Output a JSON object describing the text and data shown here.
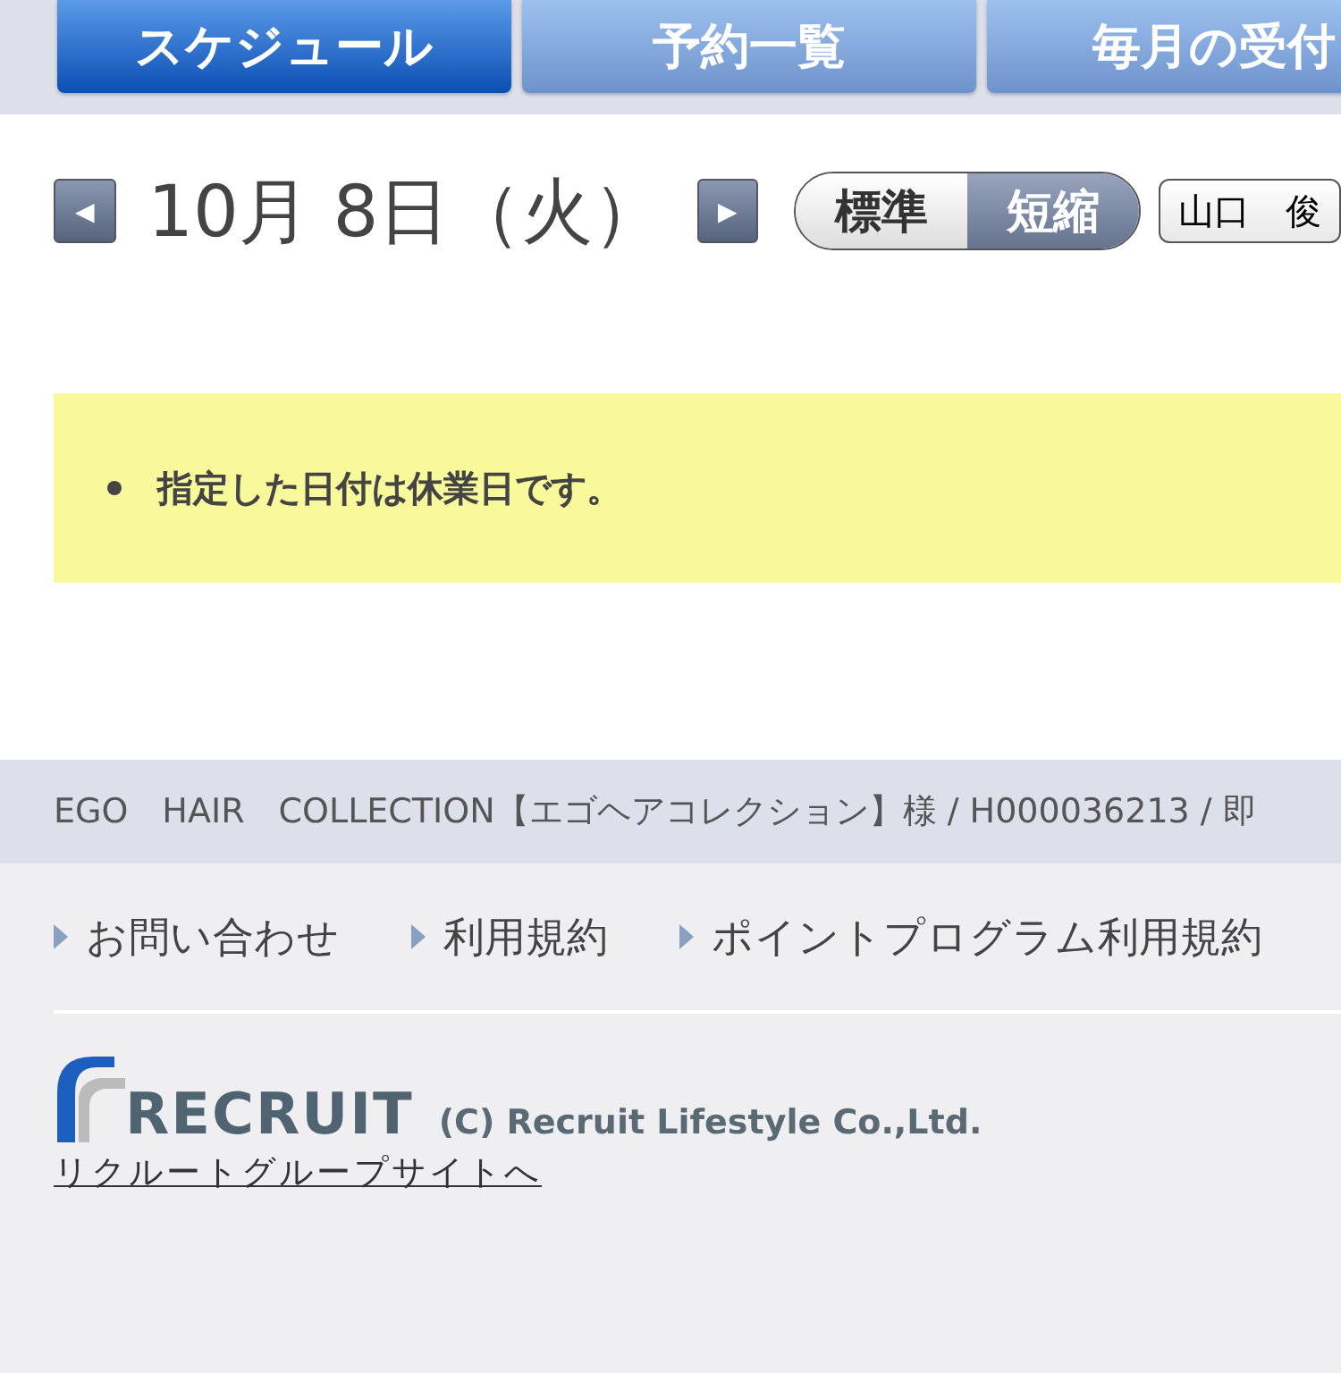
{
  "tabs": [
    {
      "label": "スケジュール",
      "selected": true
    },
    {
      "label": "予約一覧",
      "selected": false
    },
    {
      "label": "毎月の受付",
      "selected": false
    }
  ],
  "date_bar": {
    "prev": "◀",
    "date": "10月 8日（火）",
    "next": "▶",
    "view_modes": [
      {
        "label": "標準",
        "selected": false
      },
      {
        "label": "短縮",
        "selected": true
      }
    ],
    "staff_select": "山口　俊"
  },
  "notice": {
    "messages": [
      "指定した日付は休業日です。"
    ]
  },
  "salon_info": "EGO　HAIR　COLLECTION【エゴヘアコレクション】様 / H000036213 / 即",
  "footer": {
    "links": [
      "お問い合わせ",
      "利用規約",
      "ポイントプログラム利用規約"
    ],
    "logo": "RECRUIT",
    "copyright": "(C) Recruit Lifestyle Co.,Ltd.",
    "group_link": "リクルートグループサイトへ"
  }
}
